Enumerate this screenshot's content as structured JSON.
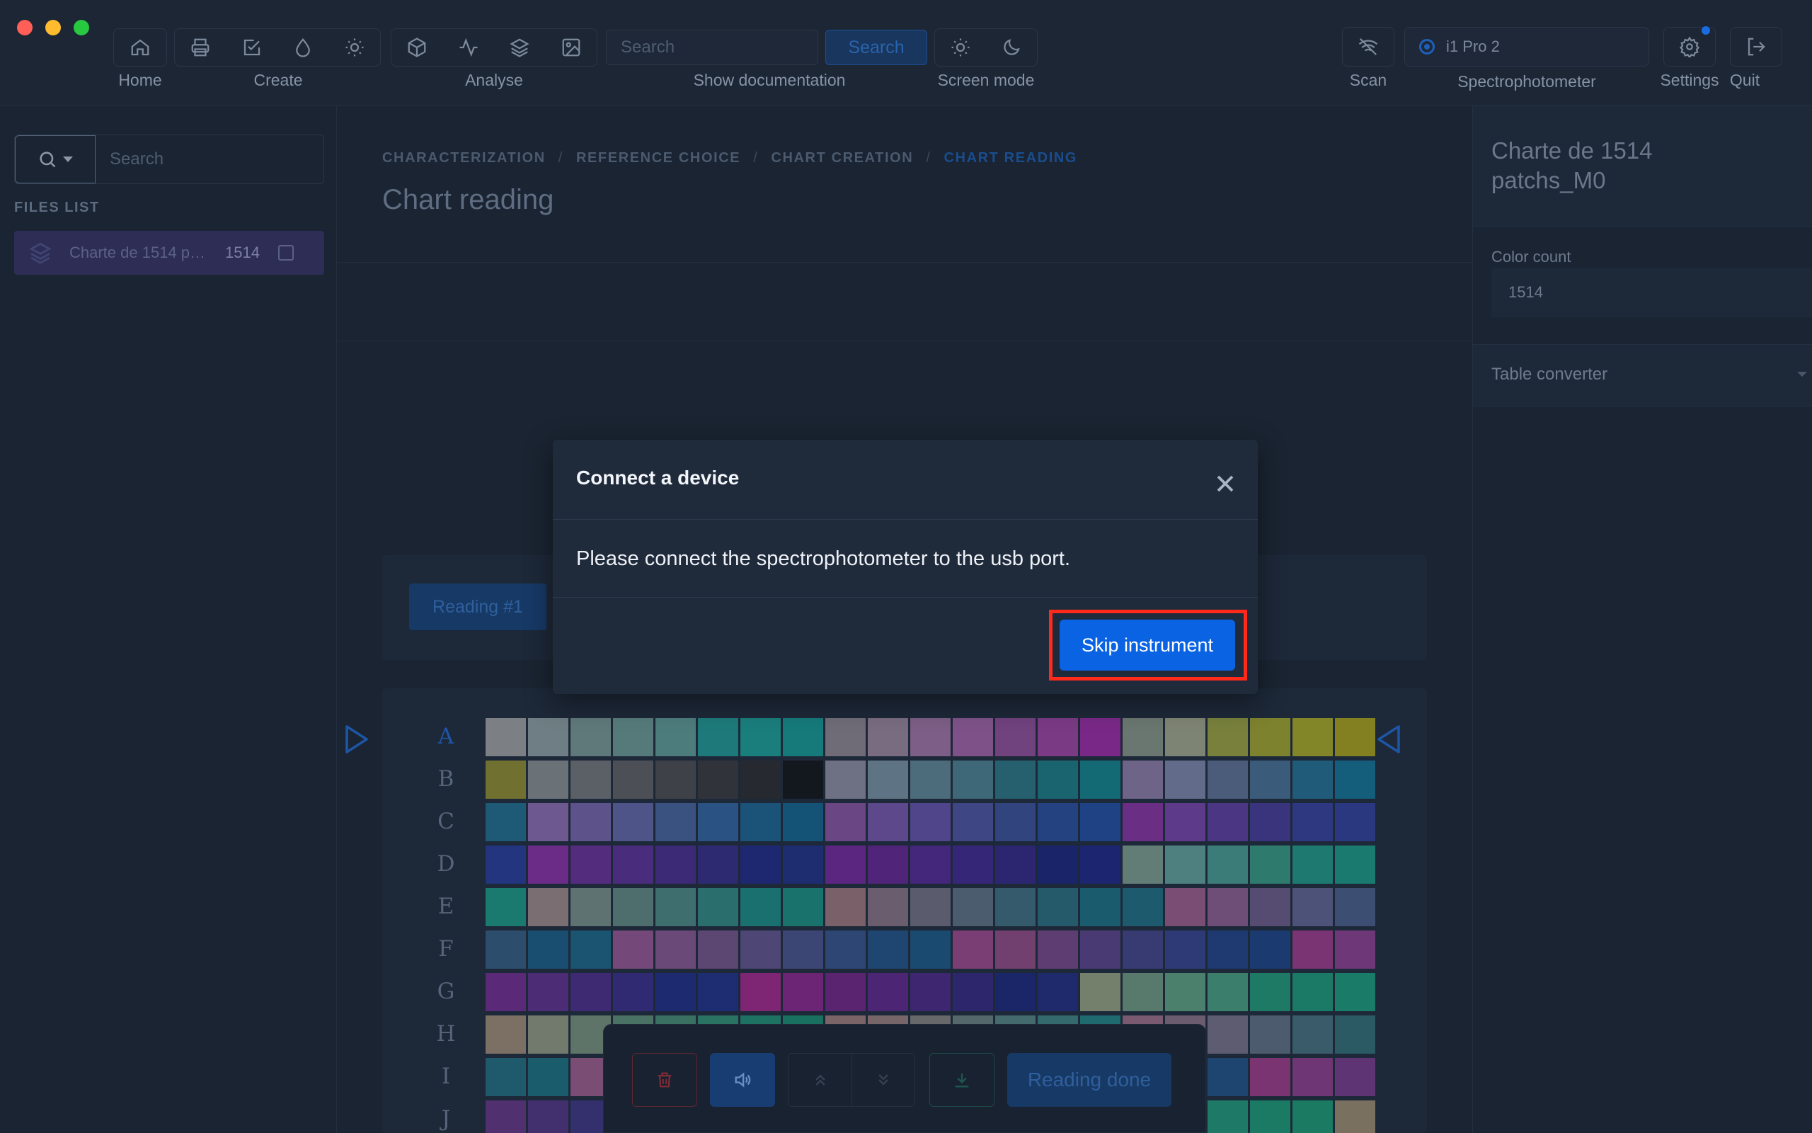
{
  "toolbar": {
    "labels": {
      "home": "Home",
      "create": "Create",
      "analyse": "Analyse",
      "show_documentation": "Show documentation",
      "screen_mode": "Screen mode",
      "scan": "Scan",
      "spectrophotometer": "Spectrophotometer",
      "settings": "Settings",
      "quit": "Quit"
    },
    "search_placeholder": "Search",
    "search_button": "Search",
    "spectrophotometer_value": "i1 Pro 2"
  },
  "sidebar": {
    "search_placeholder": "Search",
    "files_title": "FILES LIST",
    "files": [
      {
        "name": "Charte de 1514 patchs_M0",
        "count": "1514"
      }
    ]
  },
  "main": {
    "breadcrumb": [
      "CHARACTERIZATION",
      "REFERENCE CHOICE",
      "CHART CREATION",
      "CHART READING"
    ],
    "title": "Chart reading",
    "reading_tab": "Reading #1",
    "row_labels": [
      "A",
      "B",
      "C",
      "D",
      "E",
      "F",
      "G",
      "H",
      "I",
      "J"
    ],
    "active_row": "A",
    "patch_rows": [
      [
        "#7c8084",
        "#6e7e84",
        "#5f787a",
        "#567a7a",
        "#4d7c7c",
        "#1e7a7a",
        "#1a7e7c",
        "#167a7a",
        "#6f6c78",
        "#7a6c80",
        "#7c5e86",
        "#7e5288",
        "#70427e",
        "#7a3a84",
        "#7a2888",
        "#6a7670",
        "#7e8474",
        "#78803c",
        "#7c822e",
        "#828628",
        "#828020"
      ],
      [
        "#707030",
        "#6a7278",
        "#5a6066",
        "#4c5056",
        "#3e4248",
        "#30343a",
        "#262a30",
        "#12181e",
        "#6e7084",
        "#5e7484",
        "#4c6c7c",
        "#3e6878",
        "#26606e",
        "#1a6470",
        "#146a74",
        "#6e6488",
        "#626c8a",
        "#4a5c7a",
        "#3a5c7a",
        "#205c7a",
        "#145e7c"
      ],
      [
        "#1e5a76",
        "#6e5890",
        "#5e528a",
        "#4e5488",
        "#3a5280",
        "#2a5282",
        "#1a5278",
        "#145276",
        "#6a4684",
        "#5c488a",
        "#50448a",
        "#3e4684",
        "#32447e",
        "#244280",
        "#1e4284",
        "#6a2e84",
        "#5e3a8a",
        "#4a3682",
        "#3a347c",
        "#2e3880",
        "#2a3880"
      ],
      [
        "#22357e",
        "#6a2c86",
        "#542c7e",
        "#4a2c7c",
        "#3c2a76",
        "#2e2a72",
        "#1e2870",
        "#1e2c70",
        "#5a2680",
        "#502478",
        "#44267a",
        "#362678",
        "#2c2670",
        "#1a2468",
        "#1c2670",
        "#627c76",
        "#4e8080",
        "#3c7c78",
        "#2e7a6c",
        "#1e7a70",
        "#1a7a70"
      ],
      [
        "#1a7a70",
        "#7a6e72",
        "#5e7272",
        "#4e6e6e",
        "#3e6e6e",
        "#2a6e6e",
        "#1a706e",
        "#1a726c",
        "#7a6068",
        "#6a5e6e",
        "#5a5c6e",
        "#4a5c6e",
        "#345a6c",
        "#245a6a",
        "#1a5c6e",
        "#1e5a6e",
        "#7a4e74",
        "#6e4e76",
        "#564c72",
        "#4c5278",
        "#3c4e72"
      ],
      [
        "#2c4e6c",
        "#1a4e70",
        "#1a5470",
        "#744878",
        "#6a4878",
        "#5c4672",
        "#4e4674",
        "#3c4674",
        "#2e4674",
        "#1e4670",
        "#1a4a70",
        "#7a3e74",
        "#72406e",
        "#5e3e72",
        "#4a3a74",
        "#383a72",
        "#2e3a76",
        "#1e3a70",
        "#1a3a70",
        "#7a3474",
        "#6e3878"
      ],
      [
        "#5a2a78",
        "#4c2c74",
        "#3e2a72",
        "#302a72",
        "#1e2a70",
        "#1e2c72",
        "#7e2674",
        "#6c2474",
        "#5a2470",
        "#4c2674",
        "#3e2670",
        "#2e266c",
        "#1a2668",
        "#1e2a6c",
        "#74806c",
        "#587a6c",
        "#4a806c",
        "#3c7e6c",
        "#1e7a64",
        "#1a7a66",
        "#1a7c68"
      ],
      [
        "#7c7064",
        "#727a6e",
        "#5e7468",
        "#4a7264",
        "#3a7062",
        "#2a7262",
        "#1e7262",
        "#1a7060",
        "#7a6468",
        "#76666a",
        "#66686a",
        "#54686c",
        "#446a6e",
        "#346a6e",
        "#1e6a6e",
        "#7a5a70",
        "#6c5c70",
        "#5e5c70",
        "#4c5c6e",
        "#3a5c6a",
        "#2c5a64"
      ],
      [
        "#1e5a6c",
        "#1a5c6c",
        "#7a4e74",
        "#6e4e72",
        "#5e4e70",
        "#4c4e72",
        "#3e4e72",
        "#2c4e72",
        "#1e4e72",
        "#1a4e70",
        "#7a4272",
        "#6c4274",
        "#5e4270",
        "#4e4270",
        "#3e4272",
        "#2c4274",
        "#1a4270",
        "#1e4470",
        "#7a3472",
        "#6e3674",
        "#5e3474"
      ],
      [
        "#50306e",
        "#42306e",
        "#34306e",
        "#262e6c",
        "#1a2e6a",
        "#1e306c",
        "#7a2a72",
        "#6c2a70",
        "#5c2a6e",
        "#4a2a70",
        "#3c2a6c",
        "#2c2a6a",
        "#1a286a",
        "#1e2c6a",
        "#1a7a62",
        "#1a7a64",
        "#1a7c66",
        "#1e7a66",
        "#1a7a64",
        "#1a7a62",
        "#7a7060"
      ]
    ]
  },
  "action_bar": {
    "done_label": "Reading done"
  },
  "right_panel": {
    "title": "Charte de 1514 patchs_M0",
    "color_count_label": "Color count",
    "color_count_value": "1514",
    "table_converter_label": "Table converter"
  },
  "modal": {
    "title": "Connect a device",
    "message": "Please connect the spectrophotometer to the usb port.",
    "skip_button": "Skip instrument"
  }
}
